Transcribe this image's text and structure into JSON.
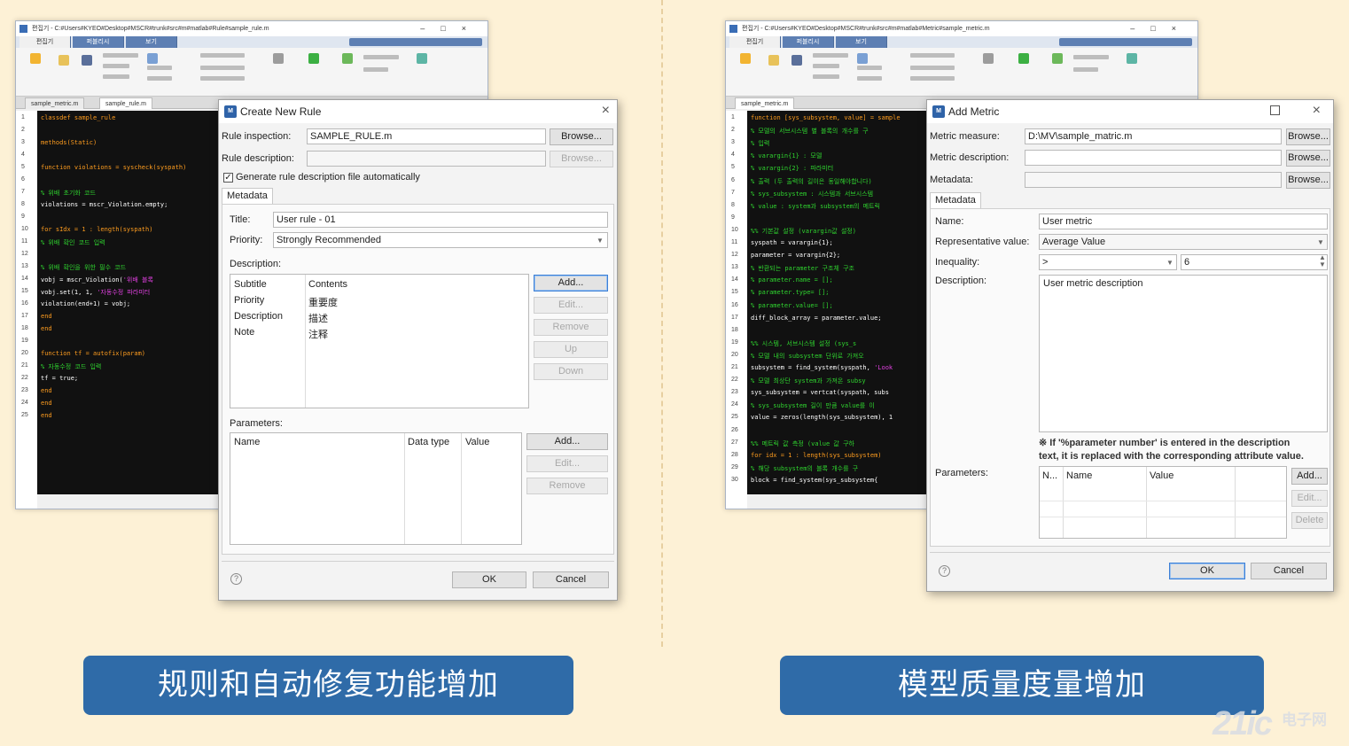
{
  "left_editor": {
    "title": "편집기 - C:#Users#KYEO#Desktop#MSCR#trunk#src#m#matlab#Rule#sample_rule.m",
    "ribbon_tabs": [
      "편집기",
      "퍼블리시",
      "보기"
    ],
    "doc_tabs": [
      "sample_metric.m",
      "sample_rule.m"
    ],
    "line_numbers": [
      "1",
      "2",
      "3",
      "4",
      "5",
      "6",
      "7",
      "8",
      "9",
      "10",
      "11",
      "12",
      "13",
      "14",
      "15",
      "16",
      "17",
      "18",
      "19",
      "20",
      "21",
      "22",
      "23",
      "24",
      "25"
    ],
    "code": [
      "classdef sample_rule",
      "",
      "    methods(Static)",
      "",
      "        function violations = syscheck(syspath)",
      "",
      "            % 위배 초기화 코드",
      "            violations = mscr_Violation.empty;",
      "",
      "            for sIdx = 1 : length(syspath)",
      "                % 위배 확인 코드 입력",
      "",
      "                % 위배 확인을 위한 필수 코드",
      "                vobj = mscr_Violation('위배 블록",
      "                vobj.set(1, 1, '자동수정 파라미터",
      "                violation(end+1) = vobj;",
      "            end",
      "        end",
      "",
      "        function tf = autofix(param)",
      "            % 자동수정 코드 입력",
      "            tf = true;",
      "        end",
      "    end",
      "end"
    ]
  },
  "create_rule_dialog": {
    "title": "Create New Rule",
    "rule_inspection_label": "Rule inspection:",
    "rule_inspection_value": "SAMPLE_RULE.m",
    "rule_description_label": "Rule description:",
    "browse_label": "Browse...",
    "auto_generate_label": "Generate rule description file automatically",
    "metadata_tab": "Metadata",
    "title_label": "Title:",
    "title_value": "User rule - 01",
    "priority_label": "Priority:",
    "priority_value": "Strongly Recommended",
    "description_label": "Description:",
    "desc_table": {
      "headers": [
        "Subtitle",
        "Contents"
      ],
      "rows": [
        [
          "Priority",
          "重要度"
        ],
        [
          "Description",
          "描述"
        ],
        [
          "Note",
          "注释"
        ]
      ]
    },
    "desc_buttons": [
      "Add...",
      "Edit...",
      "Remove",
      "Up",
      "Down"
    ],
    "parameters_label": "Parameters:",
    "param_headers": [
      "Name",
      "Data type",
      "Value"
    ],
    "param_buttons": [
      "Add...",
      "Edit...",
      "Remove"
    ],
    "ok_label": "OK",
    "cancel_label": "Cancel",
    "help_glyph": "?"
  },
  "right_editor": {
    "title": "편집기 - C:#Users#KYEO#Desktop#MSCR#trunk#src#m#matlab#Metric#sample_metric.m",
    "ribbon_tabs": [
      "편집기",
      "퍼블리시",
      "보기"
    ],
    "doc_tabs": [
      "sample_metric.m"
    ],
    "line_numbers": [
      "1",
      "2",
      "3",
      "4",
      "5",
      "6",
      "7",
      "8",
      "9",
      "10",
      "11",
      "12",
      "13",
      "14",
      "15",
      "16",
      "17",
      "18",
      "19",
      "20",
      "21",
      "22",
      "23",
      "24",
      "25",
      "26",
      "27",
      "28",
      "29",
      "30"
    ],
    "code": [
      "function [sys_subsystem, value] = sample",
      "% 모델의 서브시스템 별 블록의 개수를 구",
      "% 입력",
      "%   varargin{1} : 모델",
      "%   varargin{2} : 파라미터",
      "% 출력 (두 출력의 길이은 동일해야합니다)",
      "%   sys_subsystem : 시스템과 서브시스템",
      "%   value : system과 subsystem의 메트릭",
      "",
      "    %% 기본값 설정 (varargin값 설정)",
      "    syspath = varargin{1};",
      "    parameter = varargin{2};",
      "    % 반환되는 parameter 구조체 구조",
      "    % parameter.name = [];",
      "    % parameter.type= [];",
      "    % parameter.value= [];",
      "    diff_block_array = parameter.value;",
      "",
      "    %% 시스템, 서브시스템 설정 (sys_s",
      "    % 모델 내의 subsystem 단위로 가져오",
      "    subsystem = find_system(syspath, 'Look",
      "    % 모델 최상단 system과 가져온 subsy",
      "    sys_subsystem = vertcat(syspath, subs",
      "    % sys_subsystem 길이 만큼 value를 이",
      "    value = zeros(length(sys_subsystem), 1",
      "",
      "    %% 메트릭 값 측정 (value 값 구하",
      "    for idx = 1 : length(sys_subsystem)",
      "        % 해당 subsystem의 블록 개수를 구",
      "        block = find_system(sys_subsystem{"
    ]
  },
  "add_metric_dialog": {
    "title": "Add Metric",
    "metric_measure_label": "Metric measure:",
    "metric_measure_value": "D:\\MV\\sample_matric.m",
    "metric_description_label": "Metric description:",
    "metadata_label": "Metadata:",
    "browse_label": "Browse...",
    "metadata_tab": "Metadata",
    "name_label": "Name:",
    "name_value": "User metric",
    "rep_value_label": "Representative value:",
    "rep_value_value": "Average Value",
    "inequality_label": "Inequality:",
    "inequality_op": ">",
    "inequality_value": "6",
    "description_label": "Description:",
    "description_value": "User metric description",
    "note_line1": "※ If '%parameter number' is entered in the description",
    "note_line2": "text, it is replaced with the corresponding attribute value.",
    "parameters_label": "Parameters:",
    "param_headers": [
      "N...",
      "Name",
      "Value"
    ],
    "param_buttons": [
      "Add...",
      "Edit...",
      "Delete"
    ],
    "ok_label": "OK",
    "cancel_label": "Cancel",
    "help_glyph": "?"
  },
  "banners": {
    "left": "规则和自动修复功能增加",
    "right": "模型质量度量增加"
  },
  "watermark": {
    "logo": "21ic",
    "text": "电子网"
  },
  "colors": {
    "banner": "#2f6ba8",
    "background": "#fdf1d6",
    "code_bg": "#111111",
    "comment": "#2fd42f",
    "keyword": "#ff9d1f",
    "string": "#e040e0"
  }
}
